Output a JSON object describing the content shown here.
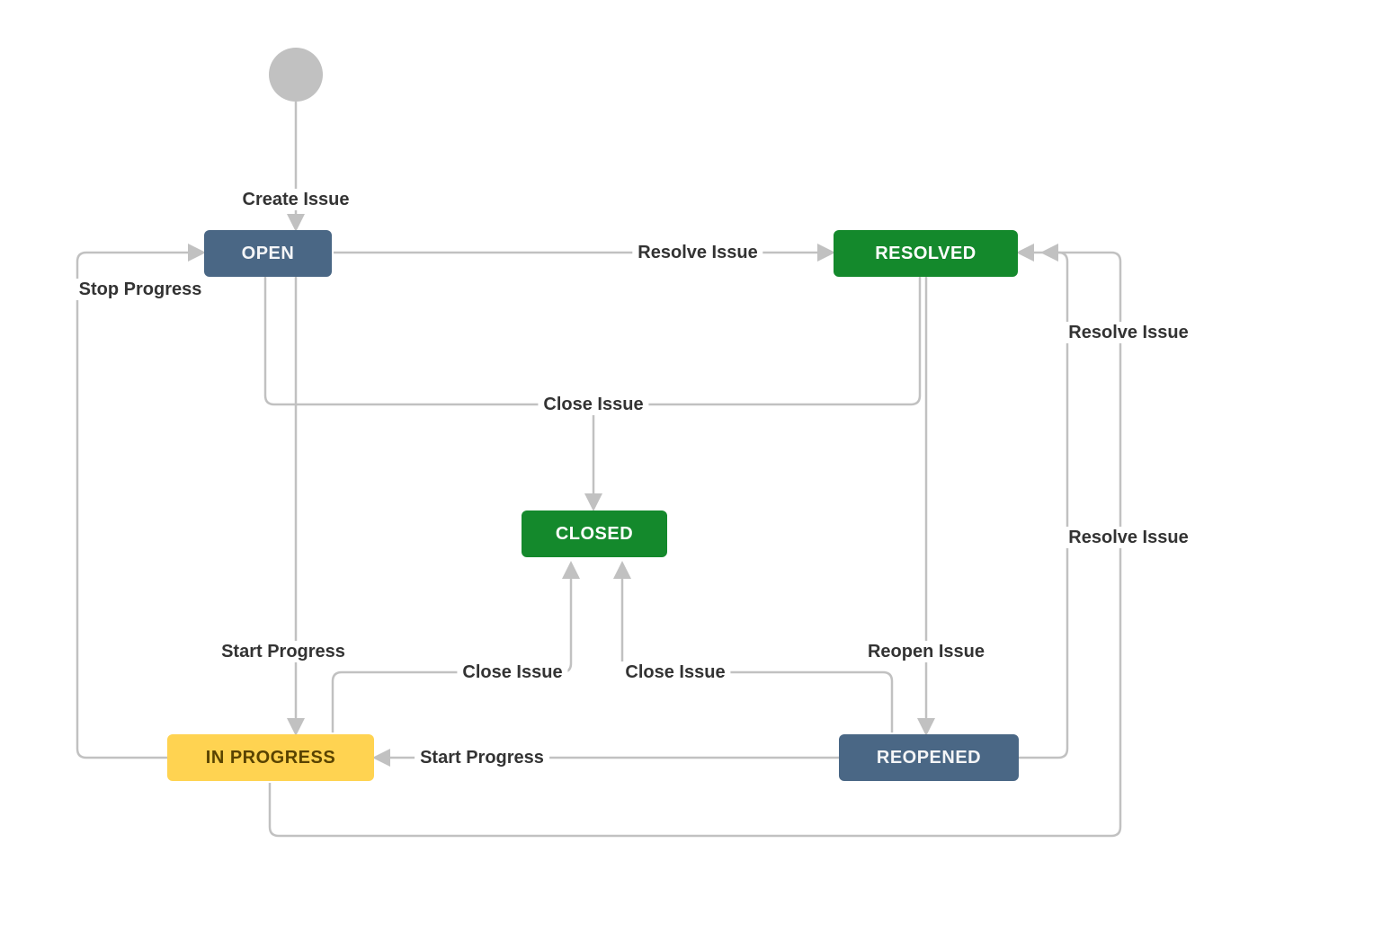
{
  "diagram": {
    "type": "state-diagram",
    "states": {
      "open": {
        "label": "OPEN",
        "kind": "todo"
      },
      "resolved": {
        "label": "RESOLVED",
        "kind": "done"
      },
      "closed": {
        "label": "CLOSED",
        "kind": "done"
      },
      "in_progress": {
        "label": "IN PROGRESS",
        "kind": "inprogress"
      },
      "reopened": {
        "label": "REOPENED",
        "kind": "todo"
      }
    },
    "transitions": {
      "create_issue": {
        "label": "Create Issue",
        "from": "START",
        "to": "open"
      },
      "open_to_resolved": {
        "label": "Resolve Issue",
        "from": "open",
        "to": "resolved"
      },
      "open_to_closed": {
        "label": "Close Issue",
        "from": "open",
        "to": "closed"
      },
      "open_to_inprogress": {
        "label": "Start Progress",
        "from": "open",
        "to": "in_progress"
      },
      "resolved_to_closed": {
        "label": "Close Issue",
        "from": "resolved",
        "to": "closed"
      },
      "resolved_to_reopened": {
        "label": "Reopen Issue",
        "from": "resolved",
        "to": "reopened"
      },
      "inprogress_to_open": {
        "label": "Stop Progress",
        "from": "in_progress",
        "to": "open"
      },
      "inprogress_to_closed": {
        "label": "Close Issue",
        "from": "in_progress",
        "to": "closed"
      },
      "inprogress_to_resolved": {
        "label": "Resolve Issue",
        "from": "in_progress",
        "to": "resolved"
      },
      "reopened_to_inprogress": {
        "label": "Start Progress",
        "from": "reopened",
        "to": "in_progress"
      },
      "reopened_to_closed": {
        "label": "Close Issue",
        "from": "reopened",
        "to": "closed"
      },
      "reopened_to_resolved": {
        "label": "Resolve Issue",
        "from": "reopened",
        "to": "resolved"
      }
    },
    "colors": {
      "todo": "#4a6785",
      "done": "#14892c",
      "inprogress": "#ffd351",
      "edge": "#c1c1c1",
      "text": "#333333"
    }
  }
}
